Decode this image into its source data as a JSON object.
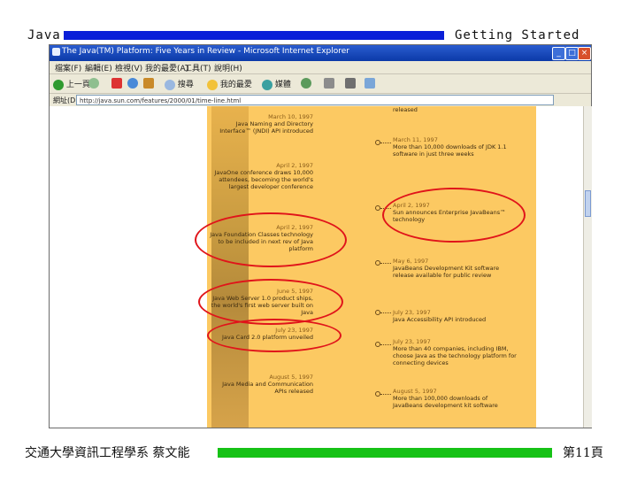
{
  "slide": {
    "header_left": "Java",
    "header_right": "Getting Started",
    "footer_left": "交通大學資訊工程學系 蔡文能",
    "footer_right": "第11頁",
    "colors": {
      "header_bar": "#0a1fd8",
      "footer_bar": "#16c216",
      "annotation": "#e0141a"
    }
  },
  "browser": {
    "title": "The Java(TM) Platform: Five Years in Review - Microsoft Internet Explorer",
    "menu": [
      "檔案(F)",
      "編輯(E)",
      "檢視(V)",
      "我的最愛(A)",
      "工具(T)",
      "說明(H)"
    ],
    "toolbar": [
      {
        "icon": "back-icon",
        "label": "上一頁"
      },
      {
        "icon": "forward-icon",
        "label": ""
      },
      {
        "icon": "stop-icon",
        "label": ""
      },
      {
        "icon": "refresh-icon",
        "label": ""
      },
      {
        "icon": "home-icon",
        "label": ""
      },
      {
        "icon": "search-icon",
        "label": "搜尋"
      },
      {
        "icon": "favorites-icon",
        "label": "我的最愛"
      },
      {
        "icon": "media-icon",
        "label": "媒體"
      },
      {
        "icon": "history-icon",
        "label": ""
      }
    ],
    "address_label": "網址(D)",
    "address": "http://java.sun.com/features/2000/01/time-line.html"
  },
  "timeline": {
    "left": [
      {
        "date": "March 10, 1997",
        "text": "Java Naming and Directory Interface™ (JNDI) API introduced"
      },
      {
        "date": "April 2, 1997",
        "text": "JavaOne conference draws 10,000 attendees, becoming the world's largest developer conference"
      },
      {
        "date": "April 2, 1997",
        "text": "Java Foundation Classes technology to be included in next rev of Java platform"
      },
      {
        "date": "June 5, 1997",
        "text": "Java Web Server 1.0 product ships, the world's first web server built on Java"
      },
      {
        "date": "July 23, 1997",
        "text": "Java Card 2.0 platform unveiled"
      },
      {
        "date": "August 5, 1997",
        "text": "Java Media and Communication APIs released"
      }
    ],
    "right": [
      {
        "date": "",
        "text": "released"
      },
      {
        "date": "March 11, 1997",
        "text": "More than 10,000 downloads of JDK 1.1 software in just three weeks"
      },
      {
        "date": "April 2, 1997",
        "text": "Sun announces Enterprise JavaBeans™ technology"
      },
      {
        "date": "May 6, 1997",
        "text": "JavaBeans Development Kit software release available for public review"
      },
      {
        "date": "July 23, 1997",
        "text": "Java Accessibility API introduced"
      },
      {
        "date": "July 23, 1997",
        "text": "More than 40 companies, including IBM, choose Java as the technology platform for connecting devices"
      },
      {
        "date": "August 5, 1997",
        "text": "More than 100,000 downloads of JavaBeans development kit software"
      }
    ]
  }
}
